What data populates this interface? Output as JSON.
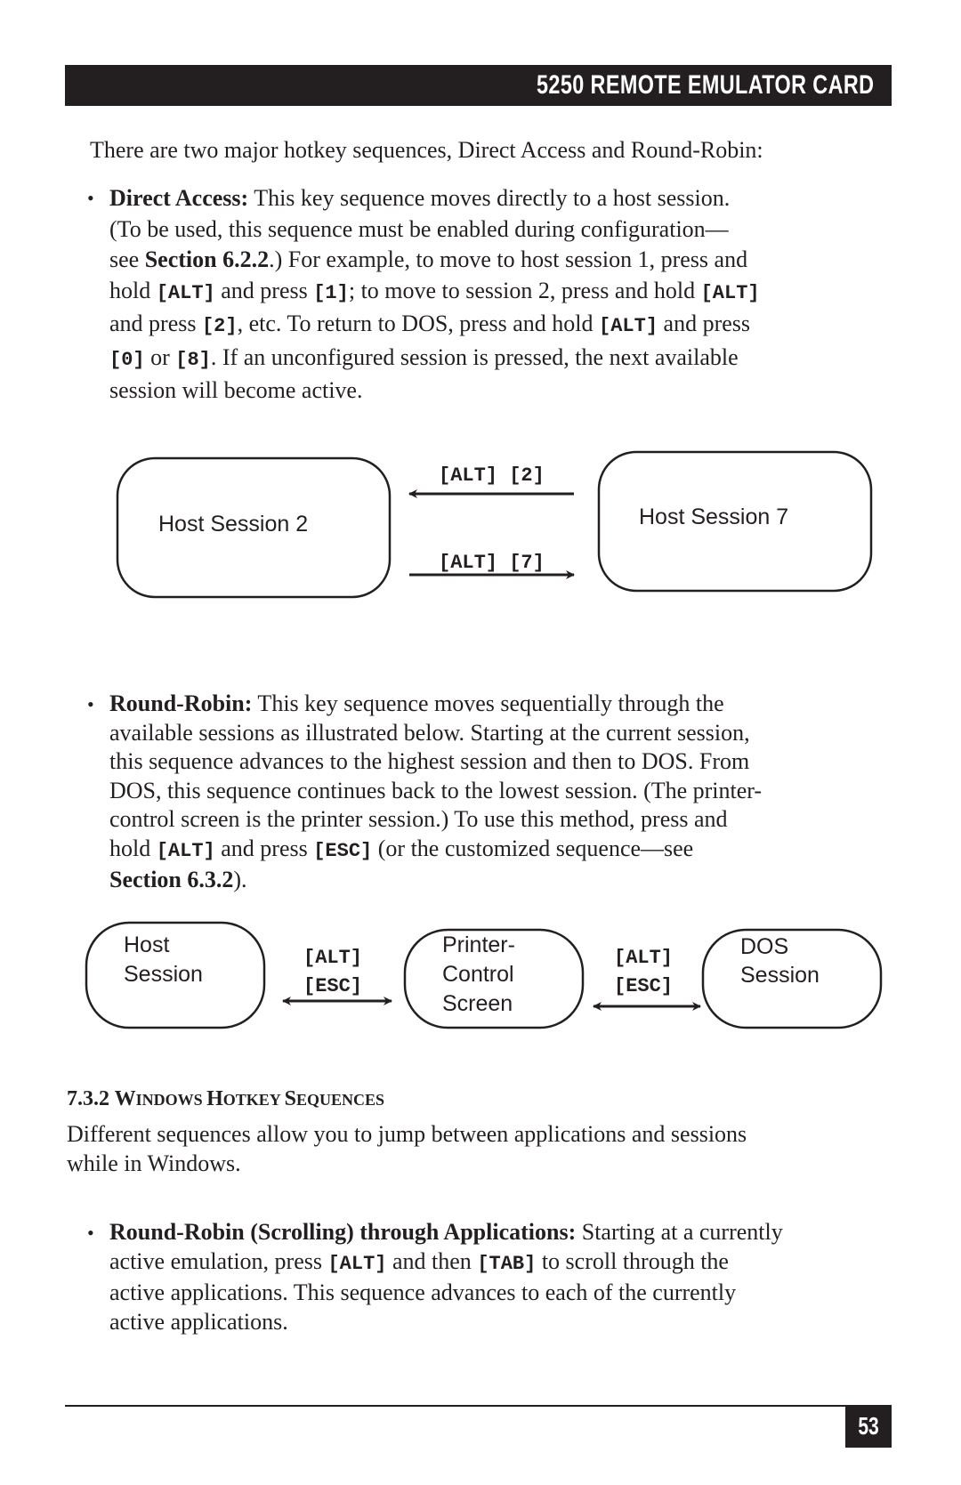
{
  "header": {
    "title": "5250 REMOTE EMULATOR CARD"
  },
  "intro": "There are two major hotkey sequences, Direct Access and Round-Robin:",
  "bullet_symbol": "•",
  "direct_access": {
    "term": "Direct Access:",
    "l1": " This key sequence moves directly to a host session.",
    "l2": "(To be used, this sequence must be enabled during configuration—",
    "l3a": "see ",
    "l3ref": "Section 6.2.2",
    "l3b": ".) For example, to move to host session 1, press and",
    "l4a": "hold ",
    "k_alt": "[ALT]",
    "l4b": " and press ",
    "k_1": "[1]",
    "l4c": "; to move to session 2, press and hold ",
    "l5a": "and press ",
    "k_2": "[2]",
    "l5b": ", etc. To return to DOS, press and hold ",
    "l5c": " and press",
    "k_0": "[0]",
    "l6a": " or ",
    "k_8": "[8]",
    "l6b": ". If an unconfigured session is pressed, the next available",
    "l7": "session will become active."
  },
  "diagram1": {
    "left_box": "Host Session 2",
    "right_box": "Host Session 7",
    "top_label": "[ALT] [2]",
    "bottom_label": "[ALT] [7]"
  },
  "round_robin": {
    "term": "Round-Robin:",
    "l1": " This key sequence moves sequentially through the",
    "l2": "available sessions as illustrated below. Starting at the current session,",
    "l3": "this sequence advances to the highest session and then to DOS. From",
    "l4": "DOS, this sequence continues back to the lowest session. (The printer-",
    "l5": "control screen is the printer session.) To use this method, press and",
    "l6a": "hold ",
    "k_alt": "[ALT]",
    "l6b": " and press ",
    "k_esc": "[ESC]",
    "l6c": " (or the customized sequence—see",
    "l7ref": "Section 6.3.2",
    "l7b": ")."
  },
  "diagram2": {
    "box1": [
      "Host",
      "Session"
    ],
    "box2": [
      "Printer-",
      "Control",
      "Screen"
    ],
    "box3": [
      "DOS",
      "Session"
    ],
    "arrow1": [
      "[ALT]",
      "[ESC]"
    ],
    "arrow2": [
      "[ALT]",
      "[ESC]"
    ]
  },
  "section": {
    "number": "7.3.2 ",
    "title_parts": [
      {
        "cap": "W",
        "rest": "INDOWS "
      },
      {
        "cap": "H",
        "rest": "OTKEY "
      },
      {
        "cap": "S",
        "rest": "EQUENCES"
      }
    ],
    "body_l1": "Different sequences allow you to jump between applications and sessions",
    "body_l2": "while in Windows."
  },
  "windows_rr": {
    "term": "Round-Robin (Scrolling) through Applications:",
    "l1": " Starting at a currently",
    "l2a": "active emulation, press ",
    "k_alt": "[ALT]",
    "l2b": " and then ",
    "k_tab": "[TAB]",
    "l2c": " to scroll through the",
    "l3": "active applications. This sequence advances to each of the currently",
    "l4": "active applications."
  },
  "footer": {
    "page_number": "53"
  }
}
